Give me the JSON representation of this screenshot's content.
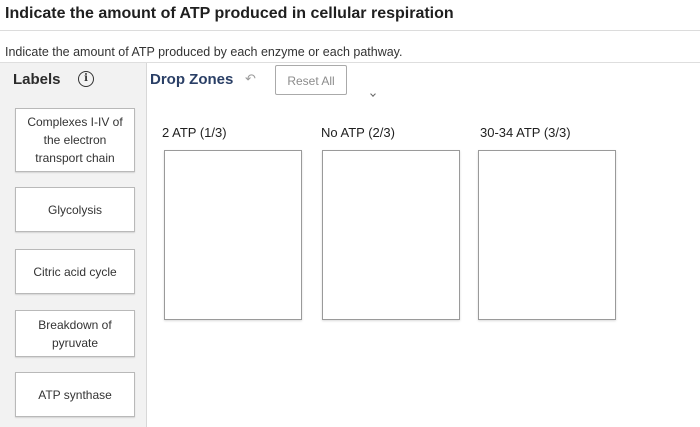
{
  "page": {
    "title": "Indicate the amount of ATP produced in cellular respiration",
    "instruction": "Indicate the amount of ATP produced by each enzyme or each pathway."
  },
  "toolbar": {
    "labels_title": "Labels",
    "info_icon": "info-icon",
    "dropzones_title": "Drop Zones",
    "undo_icon": "undo-icon",
    "reset_label": "Reset All"
  },
  "labels": [
    {
      "text": "Complexes I-IV of the electron transport chain"
    },
    {
      "text": "Glycolysis"
    },
    {
      "text": "Citric acid cycle"
    },
    {
      "text": "Breakdown of pyruvate"
    },
    {
      "text": "ATP synthase"
    }
  ],
  "drop_zones": [
    {
      "header": "2 ATP (1/3)"
    },
    {
      "header": "No ATP (2/3)"
    },
    {
      "header": "30-34 ATP (3/3)"
    }
  ],
  "colors": {
    "dropzones_title": "#2a3f66",
    "sidebar_bg": "#f2f2f2"
  }
}
